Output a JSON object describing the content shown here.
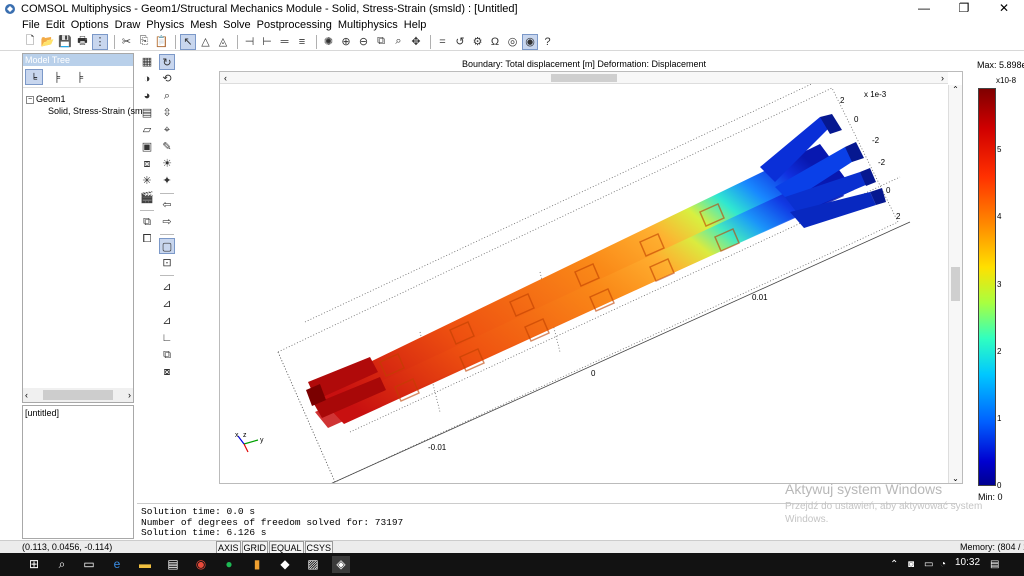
{
  "window": {
    "title": "COMSOL Multiphysics - Geom1/Structural Mechanics Module - Solid, Stress-Strain (smsld) : [Untitled]",
    "controls": [
      "—",
      "❐",
      "✕"
    ]
  },
  "menu": [
    "File",
    "Edit",
    "Options",
    "Draw",
    "Physics",
    "Mesh",
    "Solve",
    "Postprocessing",
    "Multiphysics",
    "Help"
  ],
  "model_tree": {
    "header": "Model Tree",
    "root": "Geom1",
    "child": "Solid, Stress-Strain (sm",
    "bottom_label": "[untitled]"
  },
  "plot": {
    "header": "Boundary: Total displacement [m]   Deformation: Displacement",
    "axis_scale_label": "x 1e-3",
    "tick_labels": {
      "right_top": "2",
      "right_0a": "0",
      "right_m2a": "-2",
      "right_m2b": "-2",
      "right_0b": "0",
      "right_2": "2",
      "x_001": "0.01",
      "x_0": "0",
      "x_m001": "-0.01"
    }
  },
  "legend": {
    "max_label": "Max: 5.898e-008",
    "exponent": "x10-8",
    "ticks": [
      "5",
      "4",
      "3",
      "2",
      "1",
      "0"
    ],
    "min_label": "Min: 0",
    "colors": [
      "#800000",
      "#ff3000",
      "#ffe000",
      "#30ffc0",
      "#0060ff",
      "#000090"
    ]
  },
  "log": {
    "line1": "Solution time: 0.0 s",
    "line2": "Number of degrees of freedom solved for: 73197",
    "line3": "Solution time: 6.126 s"
  },
  "watermark": {
    "title": "Aktywuj system Windows",
    "subtitle": "Przejdź do ustawień, aby aktywować system Windows."
  },
  "status": {
    "coords": "(0.113, 0.0456, -0.114)",
    "modes": [
      "AXIS",
      "GRID",
      "EQUAL",
      "CSYS"
    ],
    "memory": "Memory: (804 / 1"
  },
  "taskbar": {
    "clock": "10:32"
  }
}
